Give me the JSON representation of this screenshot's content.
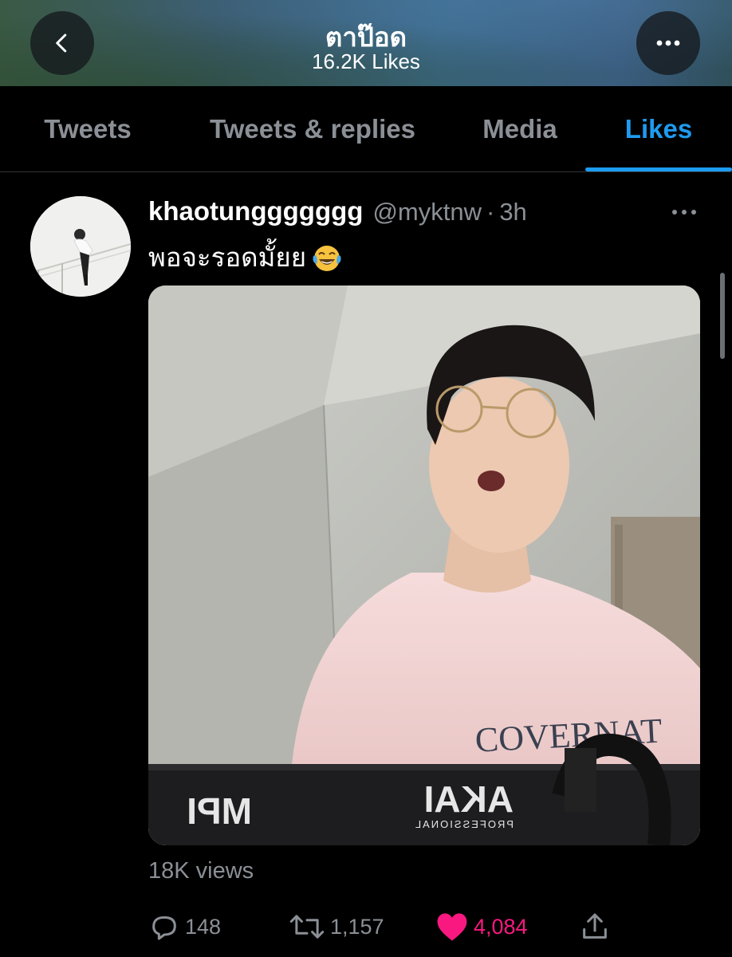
{
  "header": {
    "title": "ตาป๊อด",
    "subtitle": "16.2K Likes",
    "back_icon": "chevron-left-icon",
    "more_icon": "ellipsis-icon"
  },
  "tabs": [
    {
      "label": "Tweets",
      "active": false
    },
    {
      "label": "Tweets & replies",
      "active": false
    },
    {
      "label": "Media",
      "active": false
    },
    {
      "label": "Likes",
      "active": true
    }
  ],
  "tweet": {
    "display_name": "khaotunggggggg",
    "handle": "@myktnw",
    "separator": "·",
    "time": "3h",
    "text": "พอจะรอดมั้ยย",
    "emoji": "face-with-tears-of-joy",
    "media": {
      "type": "video",
      "overlay_text": [
        "COVERNAT",
        "AKAI",
        "PROFESSIONAL",
        "MPI"
      ]
    },
    "views": "18K views",
    "actions": {
      "reply": "148",
      "retweet": "1,157",
      "like": "4,084",
      "liked": true
    }
  },
  "colors": {
    "accent": "#1d9bf0",
    "like": "#f91880",
    "muted": "#8b9096",
    "background": "#000000"
  }
}
